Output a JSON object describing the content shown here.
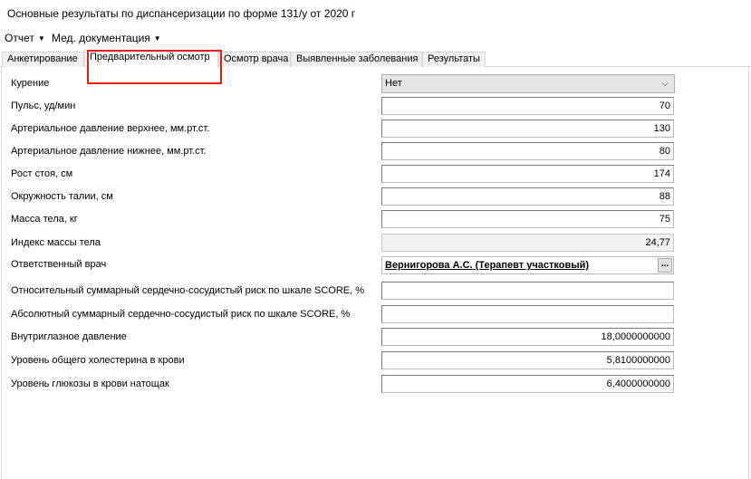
{
  "window": {
    "title": "Основные результаты по диспансеризации по форме 131/у от 2020 г"
  },
  "menu": {
    "report": "Отчет",
    "med_docs": "Мед. документация"
  },
  "tabs": [
    "Анкетирование",
    "Предварительный осмотр",
    "Осмотр врача",
    "Выявленные заболевания",
    "Результаты"
  ],
  "form": {
    "smoking": {
      "label": "Курение",
      "value": "Нет"
    },
    "pulse": {
      "label": "Пульс, уд/мин",
      "value": "70"
    },
    "bp_upper": {
      "label": "Артериальное давление верхнее, мм.рт.ст.",
      "value": "130"
    },
    "bp_lower": {
      "label": "Артериальное давление нижнее, мм.рт.ст.",
      "value": "80"
    },
    "height": {
      "label": "Рост стоя, см",
      "value": "174"
    },
    "waist": {
      "label": "Окружность талии, см",
      "value": "88"
    },
    "weight": {
      "label": "Масса тела, кг",
      "value": "75"
    },
    "bmi": {
      "label": "Индекс массы тела",
      "value": "24,77"
    },
    "doctor": {
      "label": "Ответственный врач",
      "value": "Вернигорова А.С. (Терапевт участковый)",
      "button": "..."
    },
    "score_relative": {
      "label": "Относительный суммарный сердечно-сосудистый риск по шкале SCORE, %",
      "value": ""
    },
    "score_absolute": {
      "label": "Абсолютный суммарный сердечно-сосудистый риск по шкале SCORE, %",
      "value": ""
    },
    "iop": {
      "label": "Внутриглазное давление",
      "value": "18,0000000000"
    },
    "cholesterol": {
      "label": "Уровень общего холестерина в крови",
      "value": "5,8100000000"
    },
    "glucose": {
      "label": "Уровень глюкозы в крови натощак",
      "value": "6,4000000000"
    }
  },
  "colors": {
    "highlight": "#e81b1b",
    "readonly_bg": "#f0f0f0",
    "combo_bg": "#e5e5e5"
  }
}
